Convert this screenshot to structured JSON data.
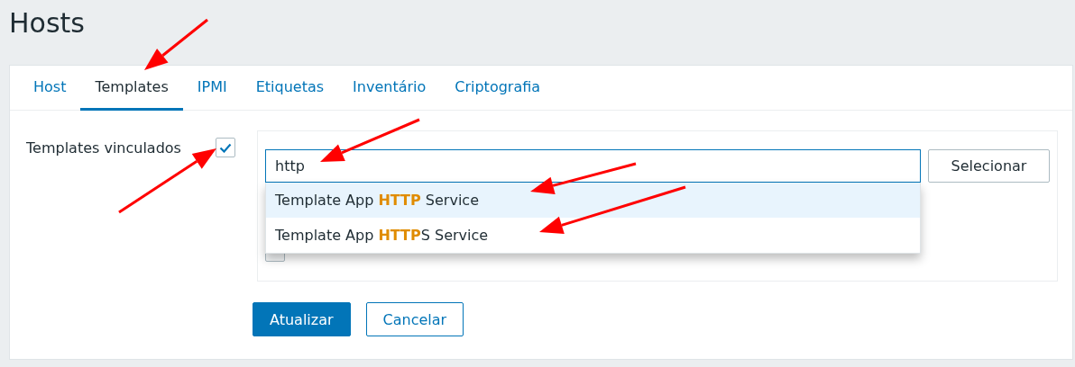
{
  "page_title": "Hosts",
  "tabs": [
    {
      "label": "Host",
      "selected": false
    },
    {
      "label": "Templates",
      "selected": true
    },
    {
      "label": "IPMI",
      "selected": false
    },
    {
      "label": "Etiquetas",
      "selected": false
    },
    {
      "label": "Inventário",
      "selected": false
    },
    {
      "label": "Criptografia",
      "selected": false
    }
  ],
  "linked_templates": {
    "label": "Templates vinculados",
    "checked": true,
    "search": {
      "value": "http"
    },
    "select_button": "Selecionar",
    "suggestions": [
      {
        "text": "Template App **HTTP** Service",
        "selected": true
      },
      {
        "text": "Template App **HTTP**S Service",
        "selected": false
      }
    ],
    "clear_checkbox": {
      "checked": false
    }
  },
  "buttons": [
    {
      "label": "Atualizar",
      "kind": "primary"
    },
    {
      "label": "Cancelar",
      "kind": "secondary"
    }
  ]
}
